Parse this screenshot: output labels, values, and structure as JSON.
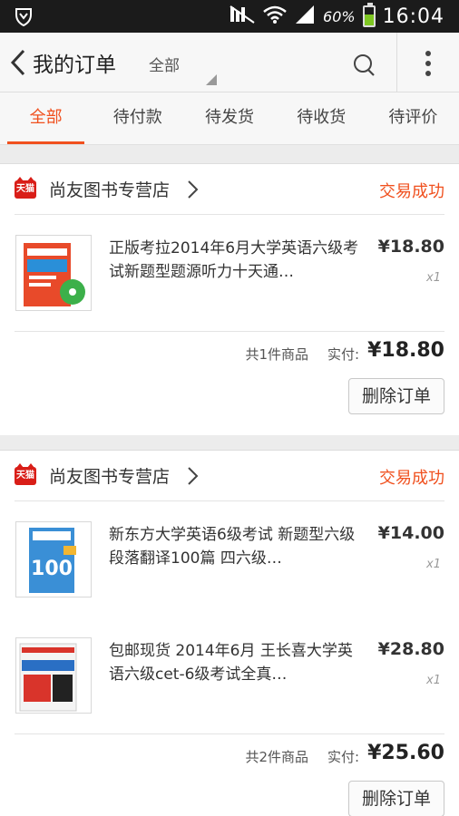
{
  "status_bar": {
    "battery_pct": "60%",
    "battery_level": 0.6,
    "time": "16:04",
    "icons": [
      "vpn-shield-icon",
      "mute-icon",
      "wifi-icon",
      "signal-icon",
      "battery-icon"
    ]
  },
  "header": {
    "title": "我的订单",
    "filter": "全部",
    "icons": [
      "back-arrow-icon",
      "search-icon",
      "more-vert-icon"
    ]
  },
  "tabs": [
    {
      "label": "全部",
      "active": true
    },
    {
      "label": "待付款",
      "active": false
    },
    {
      "label": "待发货",
      "active": false
    },
    {
      "label": "待收货",
      "active": false
    },
    {
      "label": "待评价",
      "active": false
    }
  ],
  "orders": [
    {
      "shop_badge": "天猫",
      "shop": "尚友图书专营店",
      "status": "交易成功",
      "items": [
        {
          "title": "正版考拉2014年6月大学英语六级考试新题型题源听力十天通…",
          "price": "¥18.80",
          "qty": "x1"
        }
      ],
      "count": "共1件商品",
      "paid_label": "实付:",
      "total": "¥18.80",
      "delete_label": "删除订单"
    },
    {
      "shop_badge": "天猫",
      "shop": "尚友图书专营店",
      "status": "交易成功",
      "items": [
        {
          "title": "新东方大学英语6级考试 新题型六级段落翻译100篇 四六级…",
          "price": "¥14.00",
          "qty": "x1"
        },
        {
          "title": "包邮现货 2014年6月 王长喜大学英语六级cet-6级考试全真…",
          "price": "¥28.80",
          "qty": "x1"
        }
      ],
      "count": "共2件商品",
      "paid_label": "实付:",
      "total": "¥25.60",
      "delete_label": "删除订单"
    }
  ],
  "colors": {
    "accent": "#f0501e",
    "tmall_red": "#d91e18",
    "status_bar": "#1b1b1b"
  }
}
